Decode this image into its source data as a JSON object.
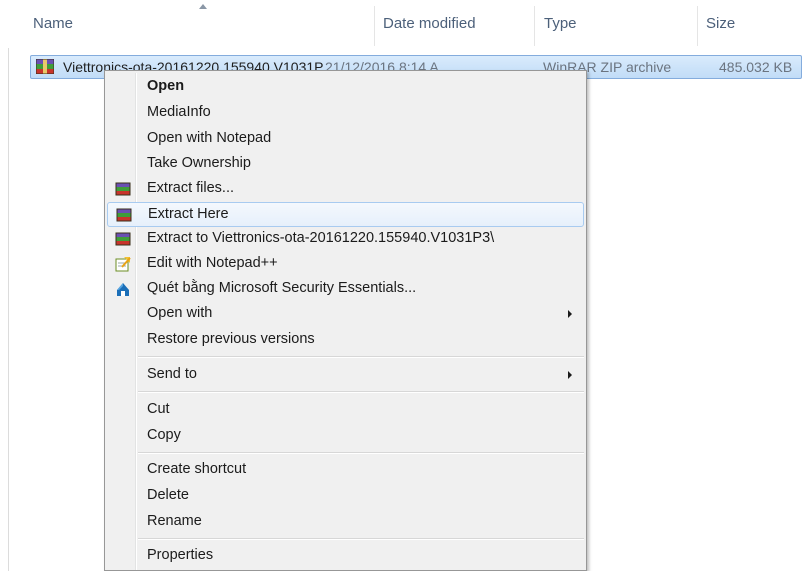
{
  "columns": {
    "name": "Name",
    "date_modified": "Date modified",
    "type": "Type",
    "size": "Size"
  },
  "file": {
    "name": "Viettronics-ota-20161220.155940.V1031P",
    "date_modified": "21/12/2016 8:14 A",
    "type": "WinRAR ZIP archive",
    "size": "485.032 KB",
    "icon": "winrar-archive-icon"
  },
  "menu": {
    "items": [
      {
        "label": "Open",
        "bold": true
      },
      {
        "label": "MediaInfo"
      },
      {
        "label": "Open with Notepad"
      },
      {
        "label": "Take Ownership"
      },
      {
        "label": "Extract files...",
        "icon": "winrar-icon"
      },
      {
        "label": "Extract Here",
        "icon": "winrar-icon",
        "highlighted": true
      },
      {
        "label": "Extract to Viettronics-ota-20161220.155940.V1031P3\\",
        "icon": "winrar-icon"
      },
      {
        "label": "Edit with Notepad++",
        "icon": "notepad-plus-plus-icon"
      },
      {
        "label": "Quét bằng Microsoft Security Essentials...",
        "icon": "security-essentials-icon"
      },
      {
        "label": "Open with",
        "submenu": true
      },
      {
        "label": "Restore previous versions"
      },
      {
        "label": "Send to",
        "submenu": true
      },
      {
        "label": "Cut"
      },
      {
        "label": "Copy"
      },
      {
        "label": "Create shortcut"
      },
      {
        "label": "Delete"
      },
      {
        "label": "Rename"
      },
      {
        "label": "Properties"
      }
    ]
  },
  "colors": {
    "selection_bg": "#cce4f7",
    "selection_border": "#84acdd",
    "menu_bg": "#f0f0f0",
    "header_text": "#4c607a"
  }
}
